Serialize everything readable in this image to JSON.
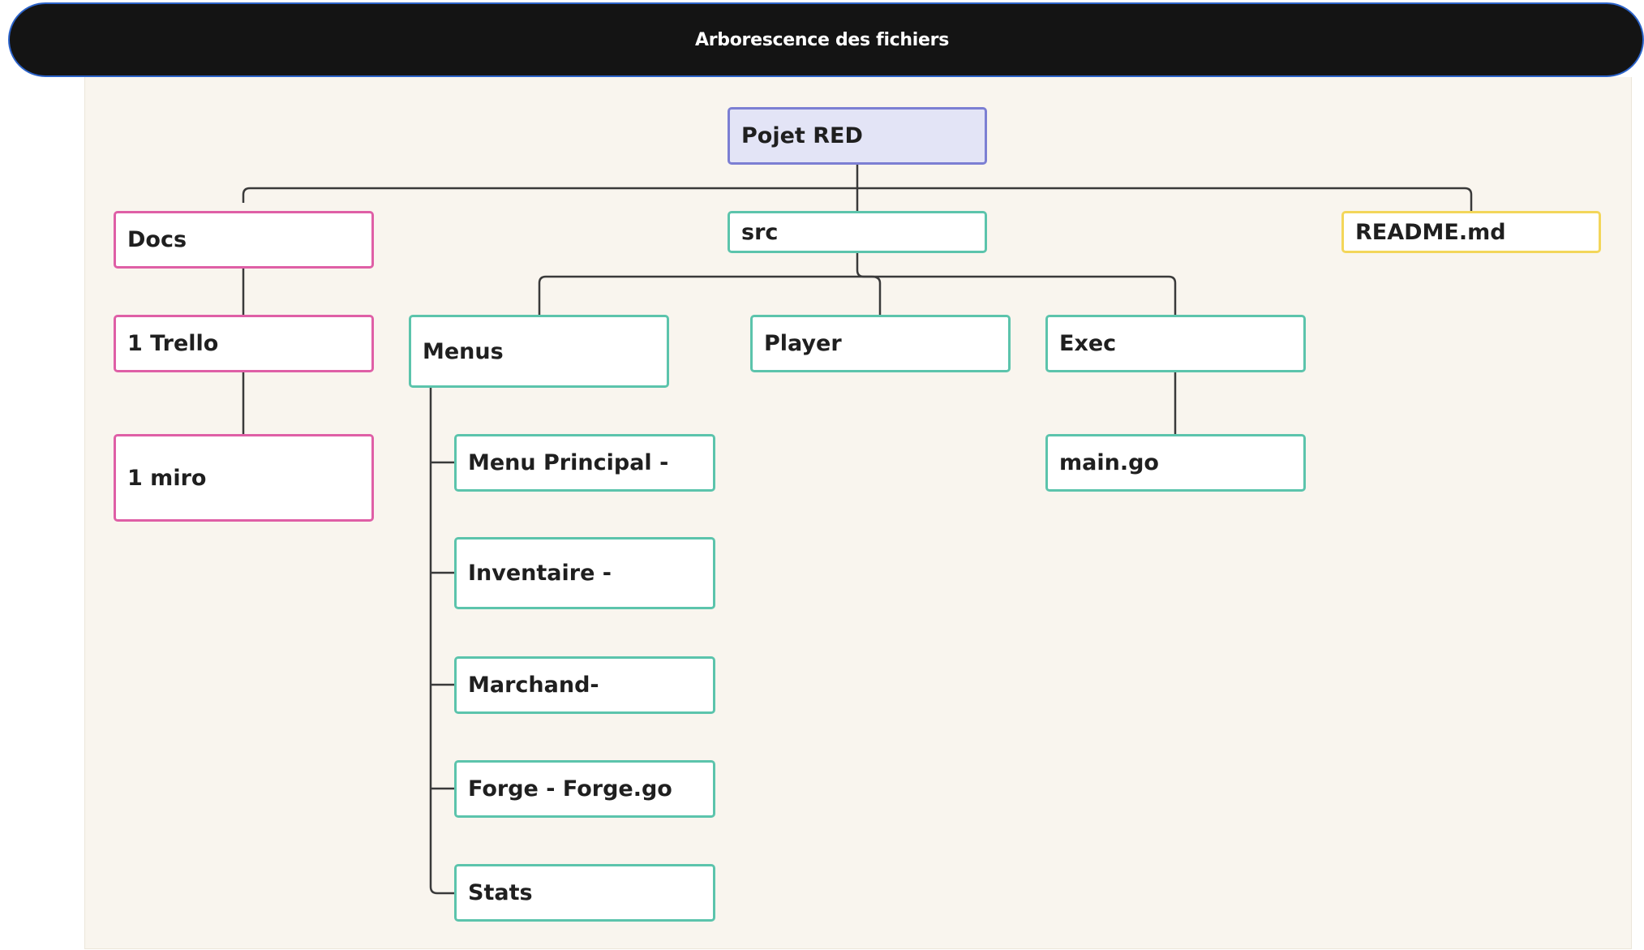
{
  "header": {
    "title": "Arborescence des fichiers"
  },
  "tree": {
    "root": "Pojet RED",
    "docs": {
      "label": "Docs",
      "children": [
        "1 Trello",
        "1 miro"
      ]
    },
    "src": {
      "label": "src",
      "children": {
        "menus": {
          "label": "Menus",
          "children": [
            "Menu Principal -",
            "Inventaire -",
            "Marchand-",
            "Forge - Forge.go",
            "Stats"
          ]
        },
        "player": "Player",
        "exec": {
          "label": "Exec",
          "children": [
            "main.go"
          ]
        }
      }
    },
    "readme": "README.md"
  },
  "colors": {
    "header_background": "#141414",
    "canvas_background": "#f9f5ee",
    "root_fill": "#e3e4f6",
    "root_border": "#7c7fd3",
    "docs_border": "#df5fa6",
    "src_border": "#5cc4ac",
    "readme_border": "#f3d65a",
    "connector": "#3a3a3a"
  }
}
